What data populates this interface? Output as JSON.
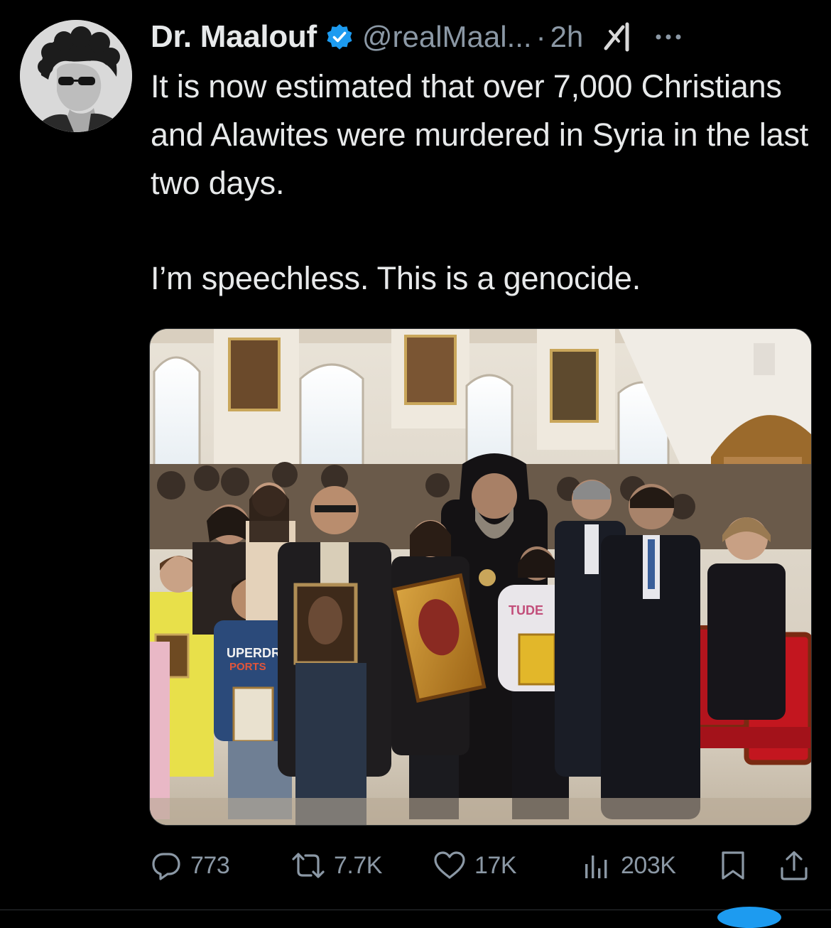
{
  "post": {
    "author": {
      "display_name": "Dr. Maalouf",
      "handle": "@realMaal...",
      "verified": true,
      "avatar_icon": "profile-photo"
    },
    "separator": "·",
    "time": "2h",
    "text": [
      "It is now estimated that over 7,000 Christians and Alawites were murdered in Syria in the last two days.",
      "I’m speechless. This is a genocide."
    ],
    "media": {
      "icon": "photo-church-congregation-holding-icons",
      "shirt_lettering": [
        "UPERDRY",
        "PORTS"
      ],
      "hoodie_lettering": "TUDE"
    }
  },
  "header_icons": {
    "grok": "grok-icon",
    "more": "more-horizontal-icon"
  },
  "actions": {
    "reply": {
      "icon": "reply-icon",
      "count": "773"
    },
    "repost": {
      "icon": "repost-icon",
      "count": "7.7K"
    },
    "like": {
      "icon": "heart-icon",
      "count": "17K"
    },
    "views": {
      "icon": "views-icon",
      "count": "203K"
    },
    "bookmark": {
      "icon": "bookmark-icon"
    },
    "share": {
      "icon": "share-icon"
    }
  },
  "colors": {
    "background": "#000000",
    "text_primary": "#e7e9ea",
    "text_secondary": "#8b98a5",
    "verified_badge": "#1d9bf0",
    "divider": "#2f3336"
  }
}
